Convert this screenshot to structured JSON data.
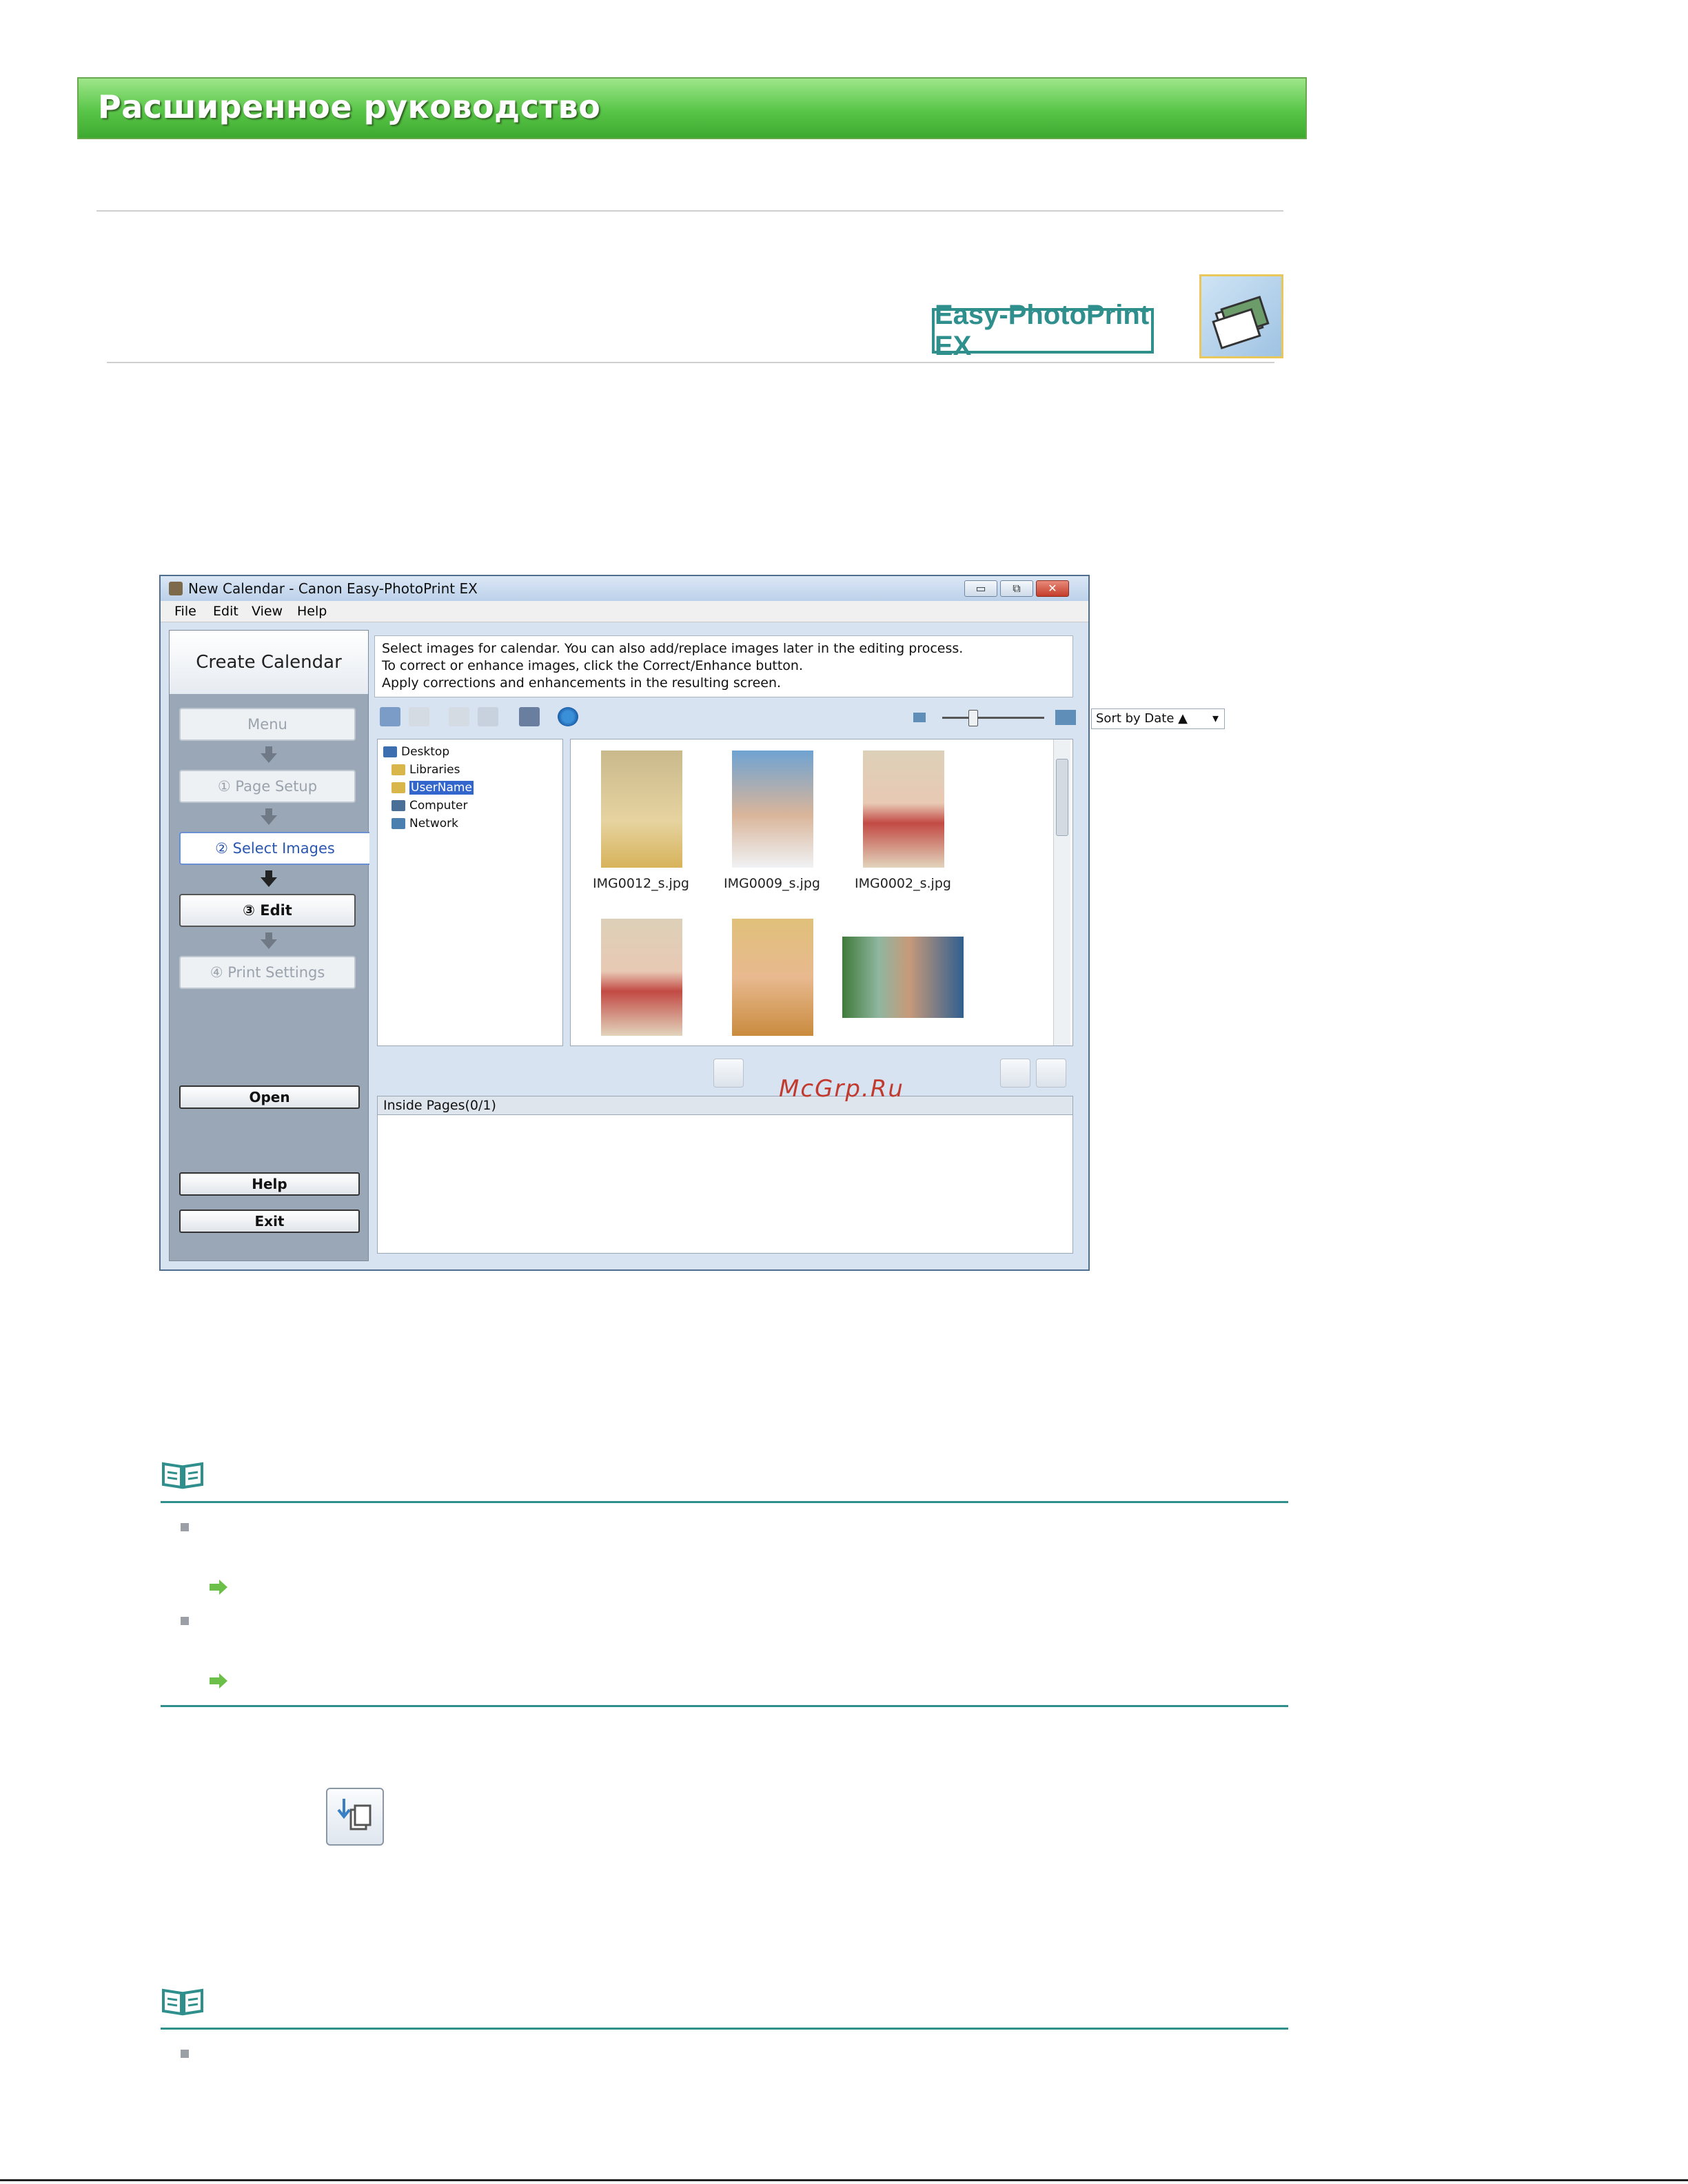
{
  "banner": {
    "title": "Расширенное руководство"
  },
  "logo": {
    "text": "Easy-PhotoPrint EX",
    "icon": "photoprint-stack-icon"
  },
  "window": {
    "title": "New Calendar - Canon Easy-PhotoPrint EX",
    "menu": [
      "File",
      "Edit",
      "View",
      "Help"
    ],
    "panel_title": "Create Calendar",
    "steps": {
      "menu": "Menu",
      "page_setup": "① Page Setup",
      "select_images": "② Select Images",
      "edit": "③ Edit",
      "print_settings": "④ Print Settings"
    },
    "buttons": {
      "open": "Open",
      "help": "Help",
      "exit": "Exit"
    },
    "instructions": [
      "Select images for calendar. You can also add/replace images later in the editing process.",
      "To correct or enhance images, click the Correct/Enhance button.",
      "Apply corrections and enhancements in the resulting screen."
    ],
    "sort": "Sort by Date ▲",
    "tree": [
      "Desktop",
      "Libraries",
      "UserName",
      "Computer",
      "Network"
    ],
    "thumbnails": [
      "IMG0012_s.jpg",
      "IMG0009_s.jpg",
      "IMG0002_s.jpg"
    ],
    "inside_pages": "Inside Pages(0/1)"
  },
  "watermark": "McGrp.Ru",
  "colors": {
    "accent": "#2f8f8c",
    "banner": "#58c548",
    "arrow": "#6cc04a"
  }
}
